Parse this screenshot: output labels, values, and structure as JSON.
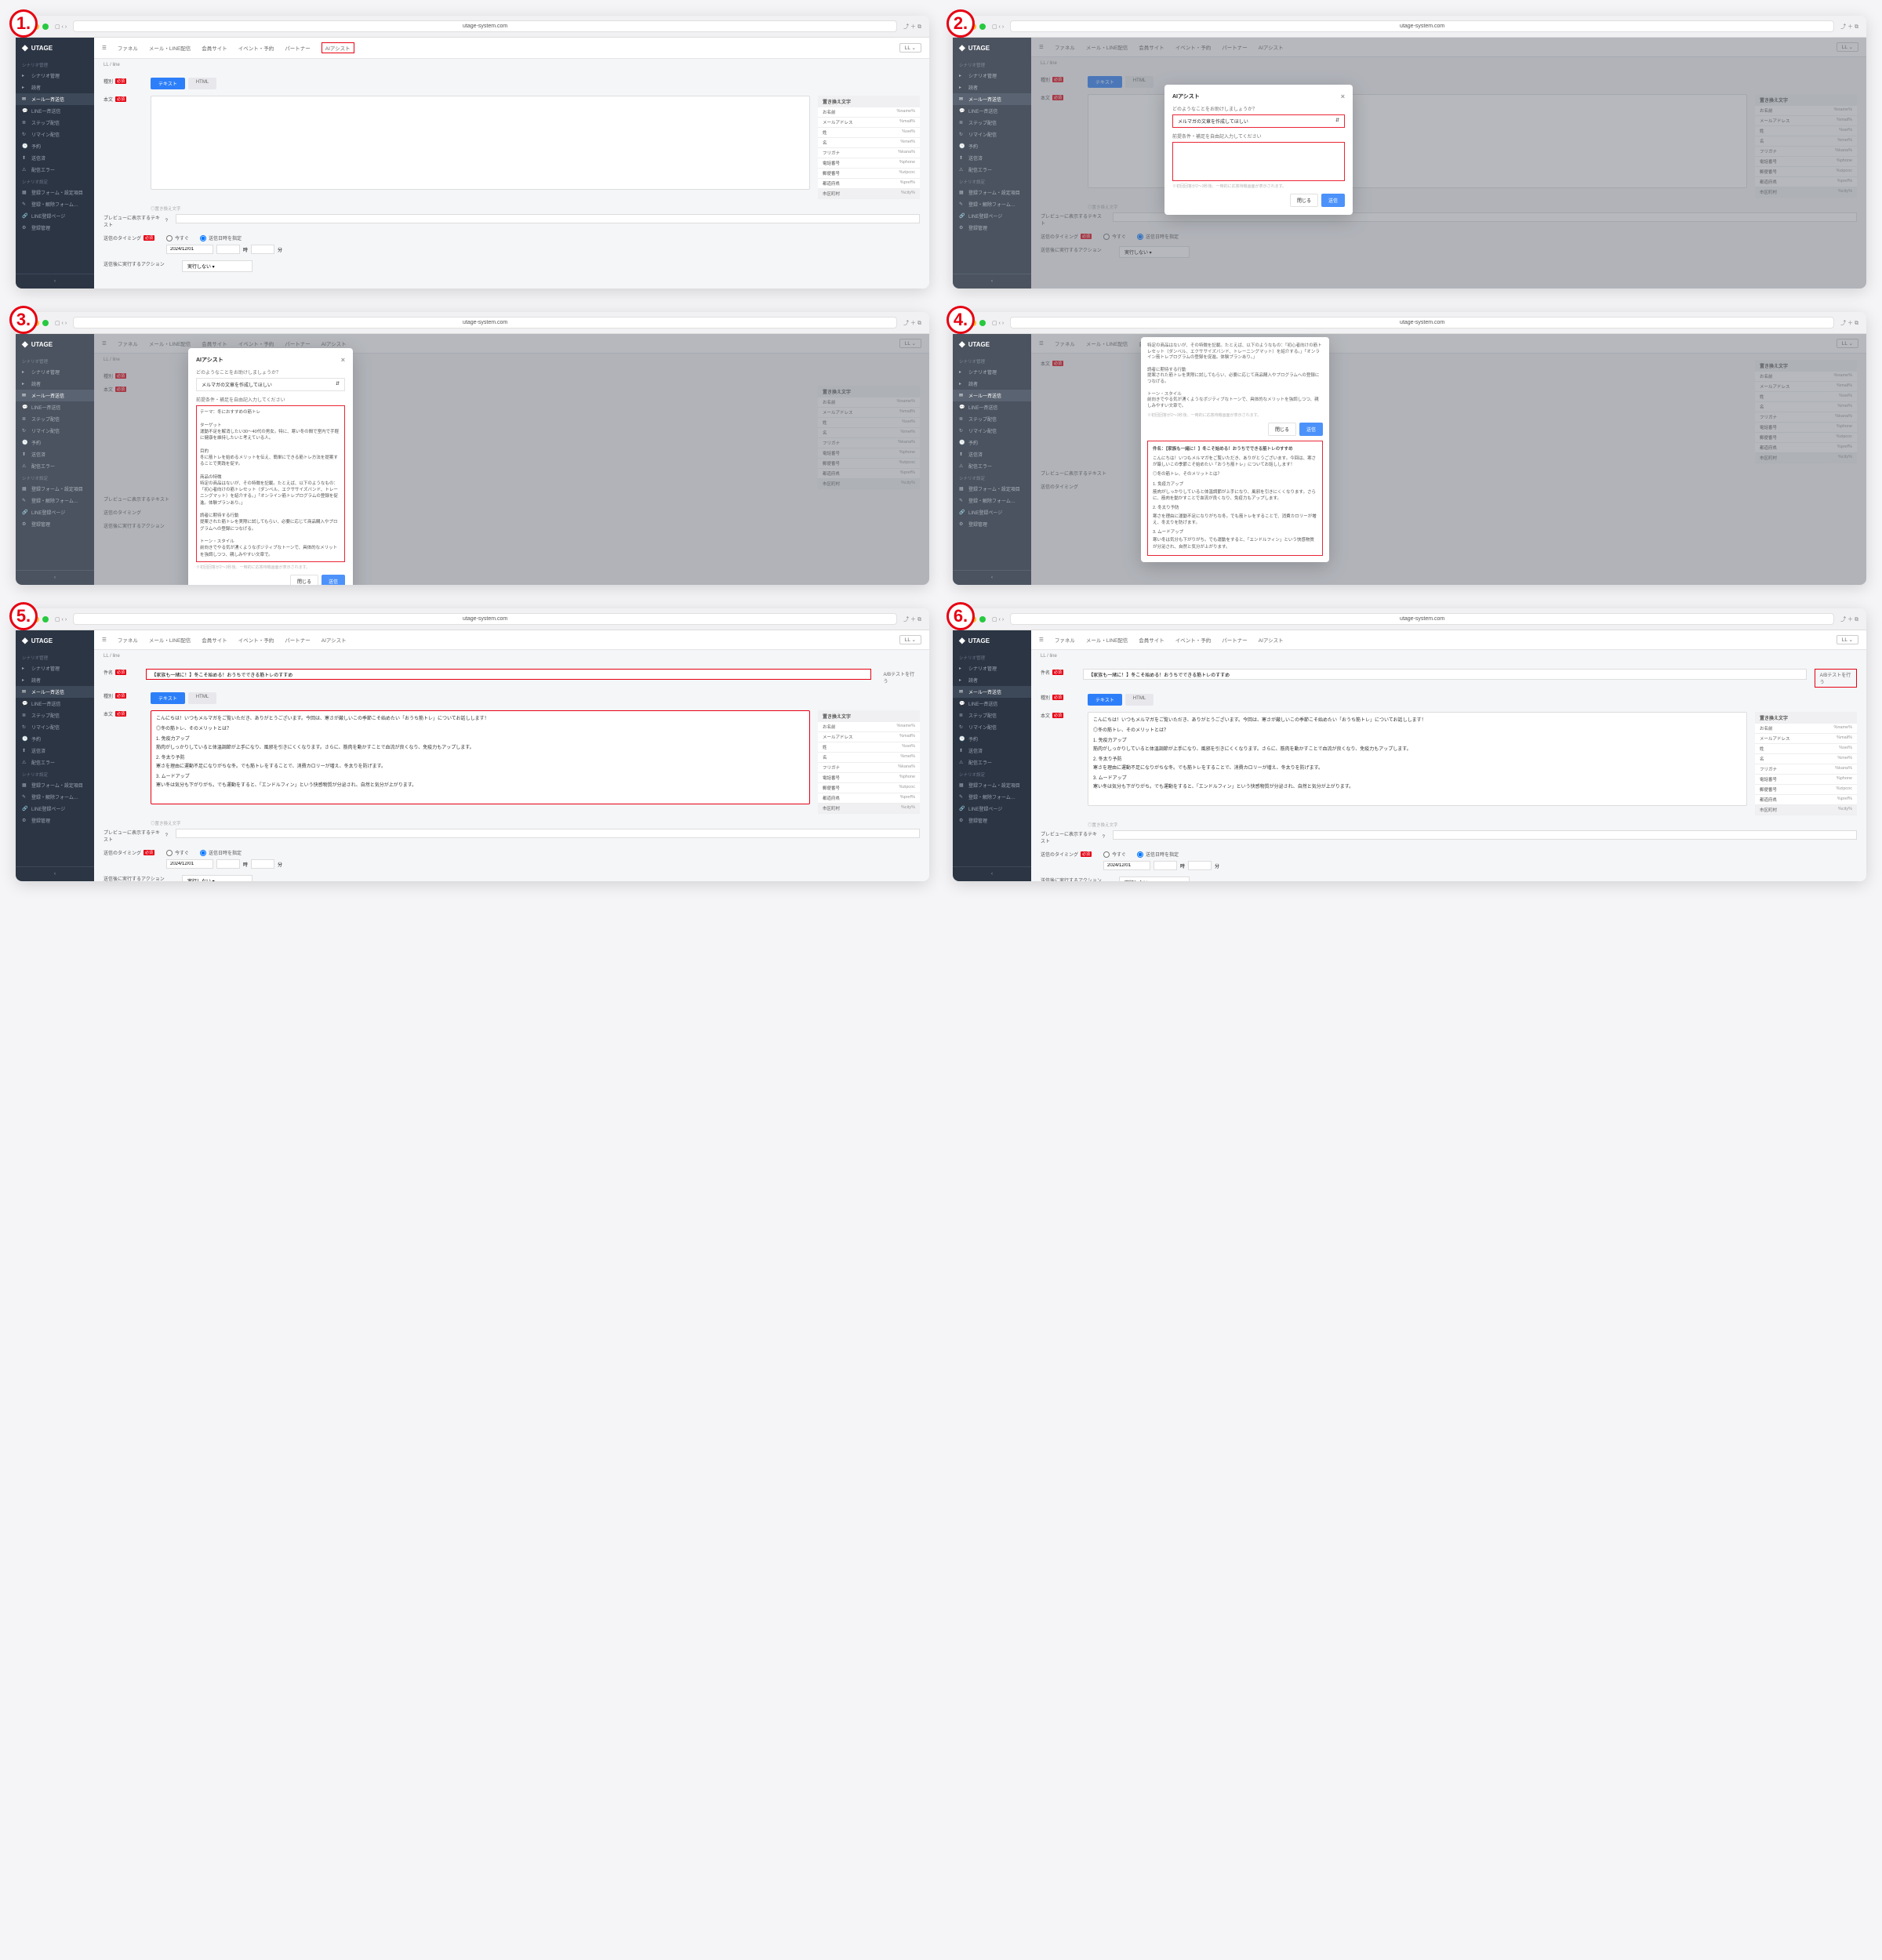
{
  "url": "utage-system.com",
  "logo": "UTAGE",
  "sidebar": {
    "group1": "シナリオ管理",
    "items1": [
      {
        "icon": "▸",
        "label": "シナリオ管理"
      },
      {
        "icon": "▸",
        "label": "読者"
      },
      {
        "icon": "✉",
        "label": "メール一斉送信",
        "active": true
      },
      {
        "icon": "💬",
        "label": "LINE一斉送信"
      },
      {
        "icon": "≣",
        "label": "ステップ配信"
      },
      {
        "icon": "↻",
        "label": "リマイン配信"
      },
      {
        "icon": "🕒",
        "label": "予約"
      },
      {
        "icon": "⬆",
        "label": "送信済"
      },
      {
        "icon": "⚠",
        "label": "配信エラー"
      }
    ],
    "group2": "シナリオ設定",
    "items2": [
      {
        "icon": "▦",
        "label": "登録フォーム・設定項目"
      },
      {
        "icon": "✎",
        "label": "登録・解除フォーム…"
      },
      {
        "icon": "🔗",
        "label": "LINE登録ページ"
      },
      {
        "icon": "⚙",
        "label": "登録管理"
      }
    ],
    "collapse": "‹"
  },
  "topbar": {
    "menu": "☰",
    "items": [
      "ファネル",
      "メール・LINE配信",
      "会員サイト",
      "イベント・予約",
      "パートナー",
      "AIアシスト"
    ],
    "ll": "LL ⌄"
  },
  "crumb": "LL / line",
  "labels": {
    "subject": "件名",
    "type": "種別",
    "body": "本文",
    "required": "必須",
    "preview": "プレビューに表示するテキスト",
    "q": "?",
    "timing": "送信のタイミング",
    "now": "今すぐ",
    "schedule": "送信日時を指定",
    "date": "2024/12/01",
    "hour": "時",
    "min": "分",
    "after": "送信後に実行するアクション",
    "noexec": "実行しない ▾",
    "abtest": "A/Bテストを行う",
    "help": "◎置き換え文字"
  },
  "tabs": {
    "text": "テキスト",
    "html": "HTML"
  },
  "vars": {
    "header": "置き換え文字",
    "rows": [
      {
        "n": "お名前",
        "v": "%name%"
      },
      {
        "n": "メールアドレス",
        "v": "%mail%"
      },
      {
        "n": "姓",
        "v": "%sei%"
      },
      {
        "n": "名",
        "v": "%mei%"
      },
      {
        "n": "フリガナ",
        "v": "%kana%"
      },
      {
        "n": "電話番号",
        "v": "%phone"
      },
      {
        "n": "郵便番号",
        "v": "%zipcoc"
      },
      {
        "n": "都道府県",
        "v": "%pref%"
      },
      {
        "n": "市区町村",
        "v": "%city%"
      }
    ]
  },
  "modal": {
    "title": "AIアシスト",
    "q1": "どのようなことをお助けしましょうか？",
    "sel": "メルマガの文章を作成してほしい",
    "arrow": "⇵",
    "q2": "前提条件・補足を自由記入力してください",
    "help": "※初回回答が2〜3秒後、一時的に応答待機画面が表示されます。",
    "close": "閉じる",
    "send": "送信"
  },
  "prompt": {
    "theme": "テーマ：冬におすすめの筋トレ",
    "p1t": "ターゲット",
    "p1": "運動不足を解消したい30〜40代の男女。特に、寒い冬の間で室内で手軽に健康を維持したいと考えている人。",
    "p2t": "目的",
    "p2": "冬に筋トレを始めるメリットを伝え、簡単にできる筋トレ方法を提案することで実践を促す。",
    "p3t": "商品の特徴",
    "p3": "特定の商品はないが、その特徴を記載。たとえば、以下のようなもの：「初心者向けの筋トレセット（ダンベル、エクササイズバンド、トレーニングマット）を紹介する。」「オンライン筋トレプログラムの登録を促進。体験プランあり。」",
    "p4t": "読者に期待する行動",
    "p4": "提案された筋トレを実際に試してもらい、必要に応じて商品購入やプログラムへの登録につなげる。",
    "p5t": "トーン・スタイル",
    "p5": "前向きでやる気が湧くようなポジティブなトーンで、具体的なメリットを強調しつつ、親しみやすい文章で。"
  },
  "result": {
    "subject": "件名：【家族も一緒に！】冬こそ始める！おうちでできる筋トレのすすめ",
    "intro": "こんにちは！いつもメルマガをご覧いただき、ありがとうございます。今回は、寒さが厳しいこの季節こそ始めたい「おうち筋トレ」についてお話しします！",
    "s0": "◎冬の筋トレ、そのメリットとは？",
    "s1t": "1. 免疫力アップ",
    "s1": "筋肉がしっかりしていると体温調節が上手になり、風邪を引きにくくなります。さらに、筋肉を動かすことで血流が良くなり、免疫力もアップします。",
    "s2t": "2. 冬太り予防",
    "s2": "寒さを理由に運動不足になりがちな冬。でも筋トレをすることで、消費カロリーが増え、冬太りを防げます。",
    "s3t": "3. ムードアップ",
    "s3": "寒い冬は気分も下がりがち。でも運動をすると、「エンドルフィン」という快感物質が分泌され、自然と気分が上がります。"
  },
  "subj6": "【家族も一緒に！】冬こそ始める！おうちでできる筋トレのすすめ",
  "body56": "こんにちは！いつもメルマガをご覧いただき、ありがとうございます。今回は、寒さが厳しいこの季節こそ始めたい「おうち筋トレ」についてお話しします！"
}
